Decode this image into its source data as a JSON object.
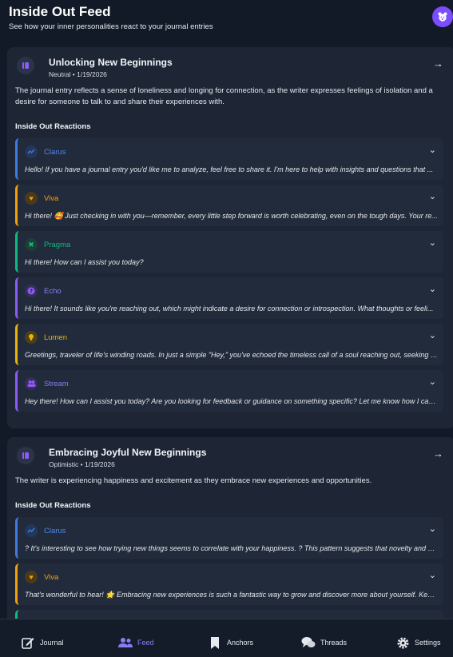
{
  "header": {
    "title": "Inside Out Feed",
    "subtitle": "See how your inner personalities react to your journal entries"
  },
  "colors": {
    "clarus": "#3f7ae0",
    "viva": "#f59e0b",
    "pragma": "#10b981",
    "echo": "#8b5cf6",
    "lumen": "#eab308",
    "stream": "#8b5cf6",
    "accent": "#7c4dff"
  },
  "entries": [
    {
      "title": "Unlocking New Beginnings",
      "meta": "Neutral • 1/19/2026",
      "summary": "The journal entry reflects a sense of loneliness and longing for connection, as the writer expresses feelings of isolation and a desire for someone to talk to and share their experiences with.",
      "reactions_title": "Inside Out Reactions",
      "reactions": [
        {
          "name": "Clarus",
          "icon": "chart-line-icon",
          "text": "Hello! If you have a journal entry you'd like me to analyze, feel free to share it. I'm here to help with insights and questions that ..."
        },
        {
          "name": "Viva",
          "icon": "heart-icon",
          "text": "Hi there! 🥰 Just checking in with you—remember, every little step forward is worth celebrating, even on the tough days. Your re..."
        },
        {
          "name": "Pragma",
          "icon": "tools-icon",
          "text": "Hi there! How can I assist you today?"
        },
        {
          "name": "Echo",
          "icon": "question-icon",
          "text": "Hi there! It sounds like you're reaching out, which might indicate a desire for connection or introspection. What thoughts or feeli..."
        },
        {
          "name": "Lumen",
          "icon": "lightbulb-icon",
          "text": "Greetings, traveler of life's winding roads. In just a simple \"Hey,\" you've echoed the timeless call of a soul reaching out, seeking co..."
        },
        {
          "name": "Stream",
          "icon": "people-icon",
          "text": "Hey there! How can I assist you today? Are you looking for feedback or guidance on something specific? Let me know how I can ..."
        }
      ]
    },
    {
      "title": "Embracing Joyful New Beginnings",
      "meta": "Optimistic • 1/19/2026",
      "summary": "The writer is experiencing happiness and excitement as they embrace new experiences and opportunities.",
      "reactions_title": "Inside Out Reactions",
      "reactions": [
        {
          "name": "Clarus",
          "icon": "chart-line-icon",
          "text": "? It's interesting to see how trying new things seems to correlate with your happiness. ? This pattern suggests that novelty and ex..."
        },
        {
          "name": "Viva",
          "icon": "heart-icon",
          "text": "That's wonderful to hear! 🌟 Embracing new experiences is such a fantastic way to grow and discover more about yourself. Keep..."
        }
      ]
    }
  ],
  "nav": [
    {
      "label": "Journal",
      "icon": "journal-edit-icon",
      "active": false
    },
    {
      "label": "Feed",
      "icon": "people-icon",
      "active": true
    },
    {
      "label": "Anchors",
      "icon": "bookmark-icon",
      "active": false
    },
    {
      "label": "Threads",
      "icon": "chat-bubbles-icon",
      "active": false
    },
    {
      "label": "Settings",
      "icon": "gear-icon",
      "active": false
    }
  ]
}
